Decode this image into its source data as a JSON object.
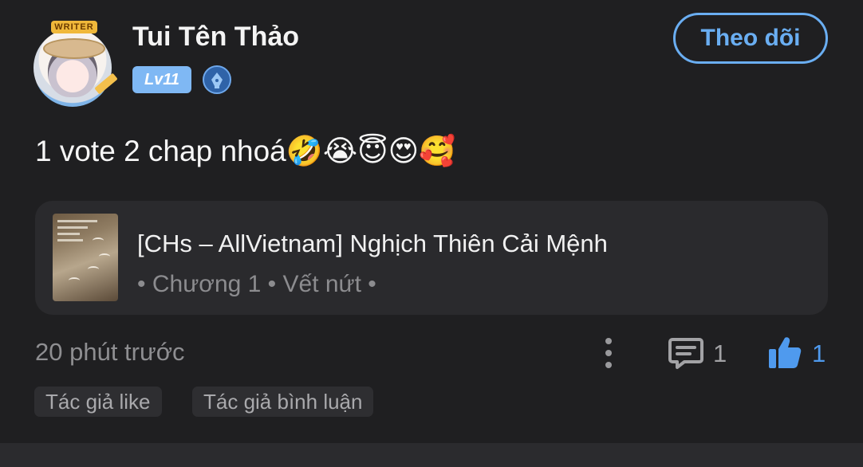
{
  "author": {
    "avatar_banner": "WRITER",
    "name": "Tui Tên Thảo",
    "level": "Lv11",
    "verified_icon": "pen-nib-icon"
  },
  "follow_button": {
    "label": "Theo dõi"
  },
  "post": {
    "text": "1 vote 2 chap nhoá🤣😭😇😍🥰"
  },
  "story_card": {
    "title": "[CHs – AllVietnam] Nghịch Thiên Cải Mệnh",
    "meta": "• Chương 1 • Vết nứt •",
    "cover_icon": "book-cover-image"
  },
  "footer": {
    "timestamp": "20 phút trước",
    "more_icon": "more-vertical-icon",
    "comment_icon": "comment-icon",
    "comment_count": "1",
    "like_icon": "thumbs-up-icon",
    "like_count": "1"
  },
  "tags": [
    "Tác giả like",
    "Tác giả bình luận"
  ],
  "colors": {
    "background": "#1f1f21",
    "card": "#2a2a2d",
    "accent": "#6aaef2",
    "like": "#4f9aee",
    "muted": "#8e8e91"
  }
}
